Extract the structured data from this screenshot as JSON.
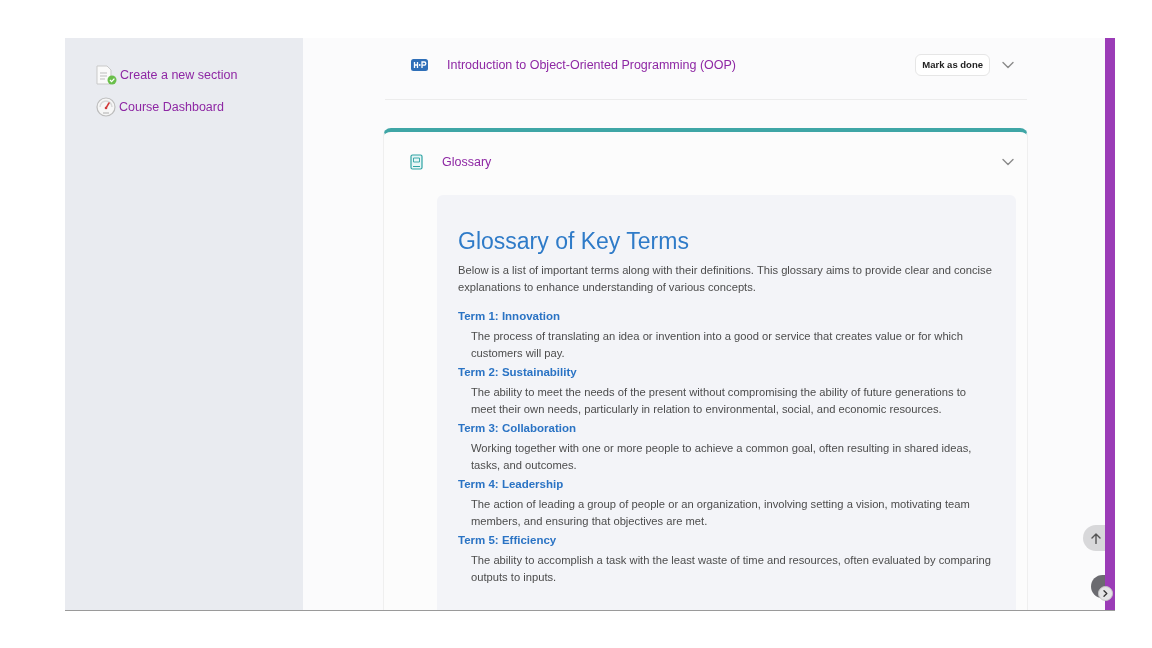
{
  "sidebar": {
    "items": [
      {
        "kind": "add-section",
        "label": "Create a new section"
      },
      {
        "kind": "dashboard",
        "label": "Course Dashboard"
      }
    ]
  },
  "sections": [
    {
      "kind": "activity",
      "title": "Introduction to Object-Oriented Programming (OOP)",
      "action": "Mark as done",
      "current": false
    },
    {
      "kind": "glossary",
      "title": "Glossary",
      "current": true,
      "content": {
        "heading": "Glossary of Key Terms",
        "intro": "Below is a list of important terms along with their definitions. This glossary aims to provide clear and concise explanations to enhance understanding of various concepts.",
        "terms": [
          {
            "term": "Term 1: Innovation",
            "definition": "The process of translating an idea or invention into a good or service that creates value or for which customers will pay."
          },
          {
            "term": "Term 2: Sustainability",
            "definition": "The ability to meet the needs of the present without compromising the ability of future generations to meet their own needs, particularly in relation to environmental, social, and economic resources."
          },
          {
            "term": "Term 3: Collaboration",
            "definition": "Working together with one or more people to achieve a common goal, often resulting in shared ideas, tasks, and outcomes."
          },
          {
            "term": "Term 4: Leadership",
            "definition": "The action of leading a group of people or an organization, involving setting a vision, motivating team members, and ensuring that objectives are met."
          },
          {
            "term": "Term 5: Efficiency",
            "definition": "The ability to accomplish a task with the least waste of time and resources, often evaluated by comparing outputs to inputs."
          }
        ]
      }
    }
  ]
}
